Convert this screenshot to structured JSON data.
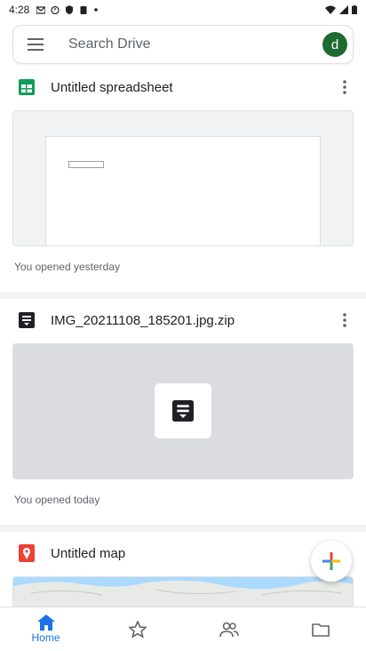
{
  "status_bar": {
    "time": "4:28",
    "left_icons": [
      "gmail-icon",
      "timer-icon",
      "shield-icon",
      "clipboard-icon",
      "dot-icon"
    ],
    "right_icons": [
      "wifi-icon",
      "signal-icon",
      "battery-icon"
    ]
  },
  "search": {
    "placeholder": "Search Drive",
    "avatar_letter": "d"
  },
  "files": [
    {
      "name": "Untitled spreadsheet",
      "icon": "sheets-icon",
      "opened": "You opened yesterday"
    },
    {
      "name": "IMG_20211108_185201.jpg.zip",
      "icon": "archive-icon",
      "opened": "You opened today"
    },
    {
      "name": "Untitled map",
      "icon": "maps-icon",
      "opened": ""
    }
  ],
  "bottom_nav": [
    {
      "label": "Home",
      "icon": "home-icon",
      "active": true
    },
    {
      "label": "",
      "icon": "star-icon",
      "active": false
    },
    {
      "label": "",
      "icon": "shared-icon",
      "active": false
    },
    {
      "label": "",
      "icon": "folder-icon",
      "active": false
    }
  ],
  "colors": {
    "accent": "#1a73e8",
    "sheets_green": "#0f9d58",
    "avatar_green": "#1e6b2f",
    "maps_red": "#ea4335"
  }
}
